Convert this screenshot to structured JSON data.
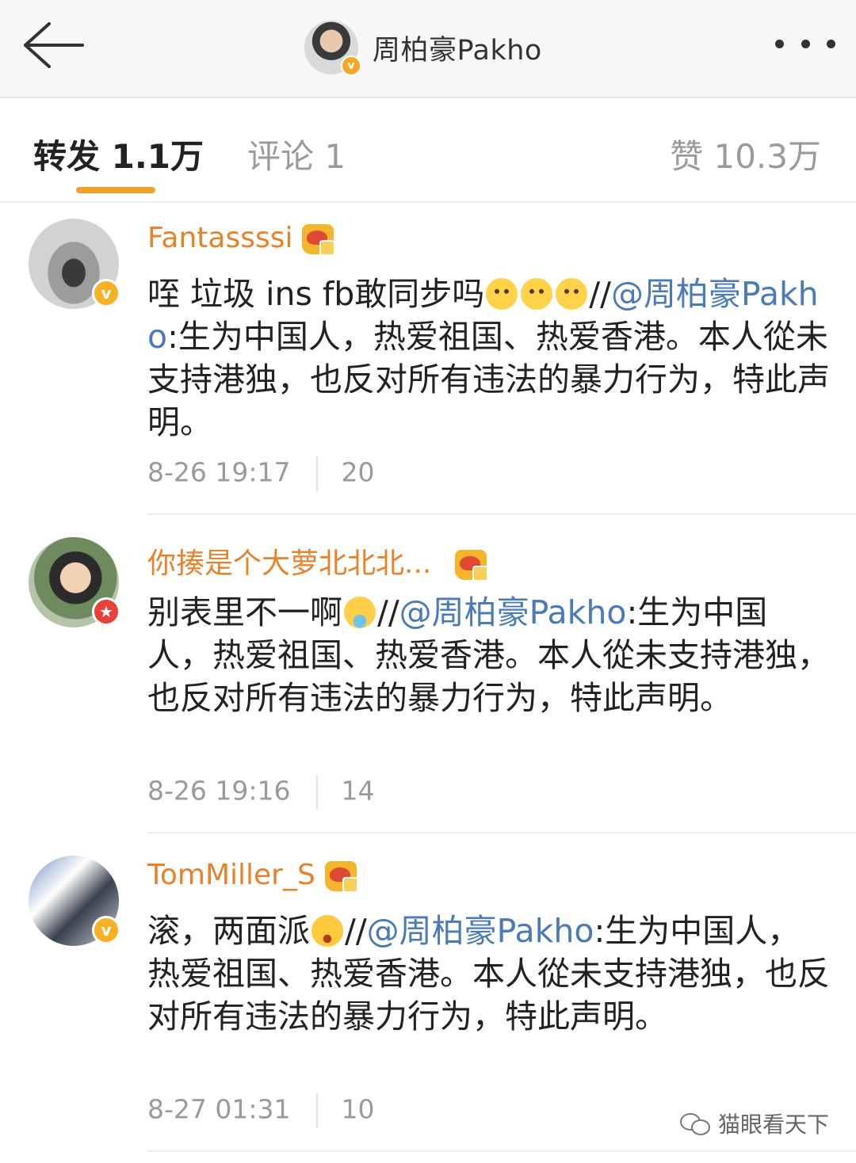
{
  "header": {
    "title": "周柏豪Pakho",
    "avatar_badge": "v"
  },
  "tabs": {
    "repost": "转发 1.1万",
    "comment": "评论 1",
    "like": "赞 10.3万"
  },
  "posts": [
    {
      "username": "Fantassssi",
      "badge": "v",
      "text_before": "咥 垃圾 ins fb敢同步吗",
      "slashes": "//",
      "mention": "@周柏豪Pakho",
      "text_after": ":生为中国人，热爱祖国、热爱香港。本人從未支持港独，也反对所有违法的暴力行为，特此声明。",
      "time": "8-26 19:17",
      "count": "20"
    },
    {
      "username": "你揍是个大萝北北北...",
      "badge": "★",
      "text_before": "别表里不一啊",
      "slashes": "//",
      "mention": "@周柏豪Pakho",
      "text_after": ":生为中国人，热爱祖国、热爱香港。本人從未支持港独，也反对所有违法的暴力行为，特此声明。",
      "time": "8-26 19:16",
      "count": "14"
    },
    {
      "username": "TomMiller_S",
      "badge": "v",
      "text_before": "滚，两面派",
      "slashes": "//",
      "mention": "@周柏豪Pakho",
      "text_after": ":生为中国人，热爱祖国、热爱香港。本人從未支持港独，也反对所有违法的暴力行为，特此声明。",
      "time": "8-27 01:31",
      "count": "10"
    }
  ],
  "watermark": "猫眼看天下",
  "colors": {
    "username": "#e8822a",
    "mention": "#4a7ab8",
    "tab_active_underline": "#f0a02b"
  }
}
